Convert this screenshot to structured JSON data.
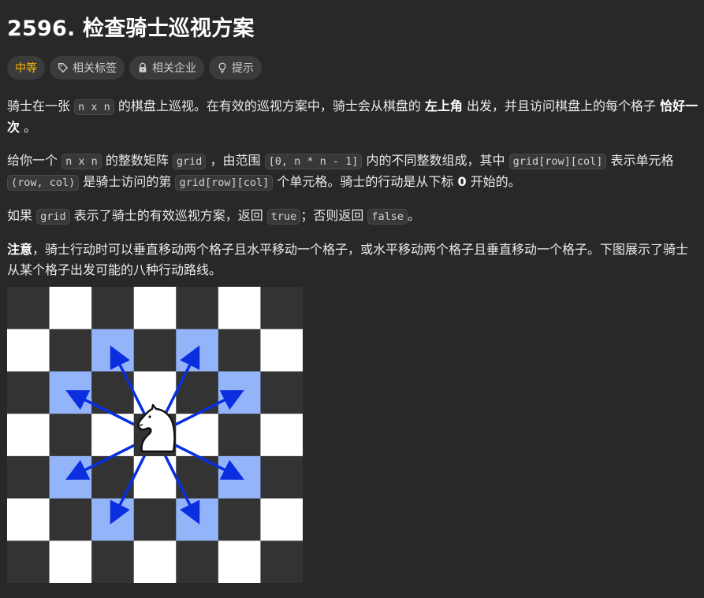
{
  "problem": {
    "title": "2596. 检查骑士巡视方案"
  },
  "tags": {
    "difficulty": "中等",
    "topics": "相关标签",
    "companies": "相关企业",
    "hint": "提示",
    "difficulty_color": "#ffb800"
  },
  "desc": {
    "p1_a": "骑士在一张 ",
    "p1_code": "n x n",
    "p1_b": " 的棋盘上巡视。在有效的巡视方案中，骑士会从棋盘的 ",
    "p1_bold1": "左上角",
    "p1_c": " 出发，并且访问棋盘上的每个格子 ",
    "p1_bold2": "恰好一次",
    "p1_d": " 。",
    "p2_a": "给你一个 ",
    "p2_code1": "n x n",
    "p2_b": " 的整数矩阵 ",
    "p2_code2": "grid",
    "p2_c": " ，由范围 ",
    "p2_code3": "[0, n * n - 1]",
    "p2_d": " 内的不同整数组成，其中 ",
    "p2_code4": "grid[row][col]",
    "p2_e": " 表示单元格 ",
    "p2_code5": "(row, col)",
    "p2_f": " 是骑士访问的第 ",
    "p2_code6": "grid[row][col]",
    "p2_g": " 个单元格。骑士的行动是从下标 ",
    "p2_bold": "0",
    "p2_h": " 开始的。",
    "p3_a": "如果 ",
    "p3_code1": "grid",
    "p3_b": " 表示了骑士的有效巡视方案，返回 ",
    "p3_code2": "true",
    "p3_c": "；否则返回 ",
    "p3_code3": "false",
    "p3_d": "。",
    "note_bold": "注意",
    "note_text": "，骑士行动时可以垂直移动两个格子且水平移动一个格子，或水平移动两个格子且垂直移动一个格子。下图展示了骑士从某个格子出发可能的八种行动路线。"
  },
  "figure": {
    "dark_color": "#333333",
    "light_color": "#ffffff",
    "highlight_color": "#94b4fa",
    "arrow_color": "#0a2ee0",
    "icon": "knight-icon"
  }
}
